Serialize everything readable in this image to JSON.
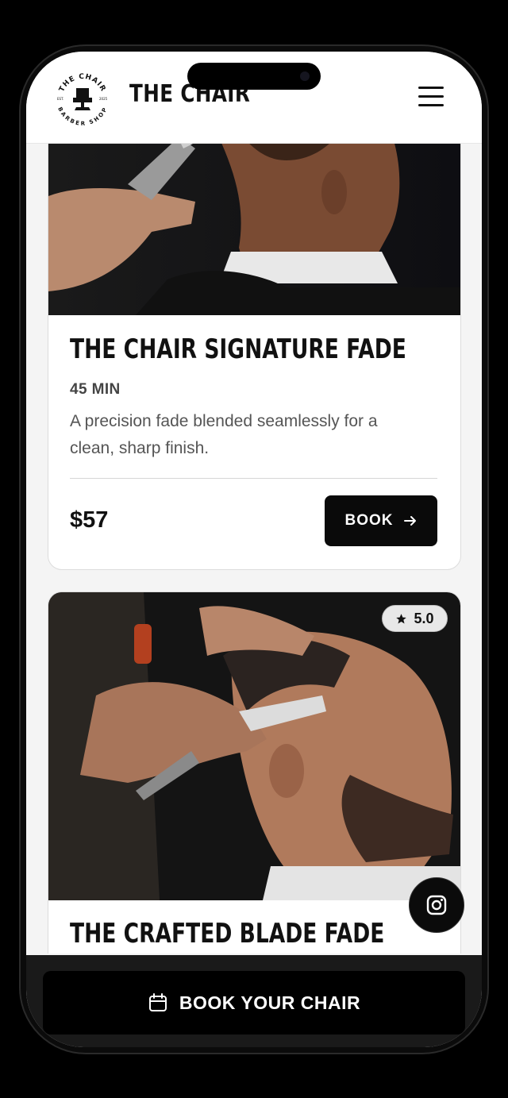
{
  "header": {
    "brand": "THE CHAIR",
    "logo_text": "THE CHAIR BARBER SHOP",
    "logo_top": "THE CHAIR",
    "logo_bottom": "BARBER SHOP",
    "logo_est": "EST.",
    "logo_year": "2025"
  },
  "services": [
    {
      "title": "THE CHAIR SIGNATURE FADE",
      "duration": "45 MIN",
      "description": "A precision fade blended seamlessly for a clean, sharp finish.",
      "price": "$57",
      "book_label": "BOOK"
    },
    {
      "title": "THE CRAFTED BLADE FADE",
      "rating": "5.0"
    }
  ],
  "cta": {
    "label": "BOOK YOUR CHAIR"
  },
  "icons": {
    "menu": "hamburger-menu-icon",
    "arrow": "arrow-right-icon",
    "star": "star-icon",
    "instagram": "instagram-icon",
    "calendar": "calendar-icon"
  },
  "colors": {
    "primary": "#0a0a0a",
    "text": "#111111",
    "muted": "#555555",
    "background": "#f4f4f4"
  }
}
